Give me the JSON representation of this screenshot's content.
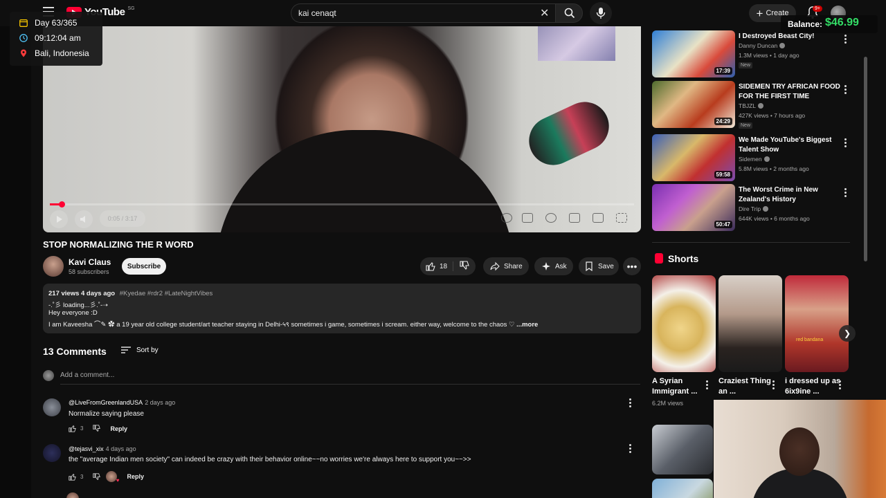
{
  "header": {
    "logo_text": "YouTube",
    "logo_cc": "SG",
    "search_query": "kai cenaqt",
    "create_label": "Create",
    "notif_count": "9+"
  },
  "overlay": {
    "day": "Day 63/365",
    "time": "09:12:04 am",
    "location": "Bali, Indonesia",
    "balance_label": "Balance:",
    "balance_value": "$46.99"
  },
  "video": {
    "title": "STOP NORMALIZING THE R WORD",
    "time_display": "0:05 / 3:17",
    "progress_fraction": 0.02,
    "channel_name": "Kavi Claus",
    "channel_subs": "58 subscribers",
    "subscribe_label": "Subscribe",
    "likes": "18",
    "share_label": "Share",
    "ask_label": "Ask",
    "save_label": "Save"
  },
  "description": {
    "stats": "217 views  4 days ago",
    "tags": "#Kyedae #rdr2 #LateNightVibes",
    "line1": "-.˚彡 loading...彡.˚-➝",
    "line2": "Hey everyone :D",
    "line3": "I am Kaveesha ⌒✎ ✿ a 19 year old college student/art teacher staying in Delhi-५९ sometimes i game, sometimes i scream. either way, welcome to the chaos ♡",
    "more": "...more"
  },
  "comments": {
    "count_label": "13 Comments",
    "sort_label": "Sort by",
    "add_placeholder": "Add a comment...",
    "items": [
      {
        "author": "@LiveFromGreenlandUSA",
        "time": "2 days ago",
        "text": "Normalize saying please",
        "likes": "3",
        "reply": "Reply"
      },
      {
        "author": "@tejasvi_xix",
        "time": "4 days ago",
        "text": "the \"average Indian men society\" can indeed be crazy with their behavior online~~no worries we're always here to support you~~>>",
        "likes": "3",
        "reply": "Reply"
      }
    ]
  },
  "recommended": [
    {
      "title": "I Destroyed Beast City!",
      "channel": "Danny Duncan",
      "meta": "1.3M views • 1 day ago",
      "badge": "New",
      "duration": "17:39"
    },
    {
      "title": "SIDEMEN TRY AFRICAN FOOD FOR THE FIRST TIME",
      "channel": "TBJZL",
      "meta": "427K views • 7 hours ago",
      "badge": "New",
      "duration": "24:29"
    },
    {
      "title": "We Made YouTube's Biggest Talent Show",
      "channel": "Sidemen",
      "meta": "5.8M views • 2 months ago",
      "badge": "",
      "duration": "59:58"
    },
    {
      "title": "The Worst Crime in New Zealand's History",
      "channel": "Dire Trip",
      "meta": "644K views • 6 months ago",
      "badge": "",
      "duration": "50:47"
    }
  ],
  "shorts": {
    "heading": "Shorts",
    "items": [
      {
        "title": "A Syrian Immigrant ...",
        "views": "6.2M views"
      },
      {
        "title": "Craziest Thing an ...",
        "views": ""
      },
      {
        "title": "i dressed up as 6ix9ine ...",
        "views": "",
        "caption": "red bandana"
      }
    ]
  }
}
